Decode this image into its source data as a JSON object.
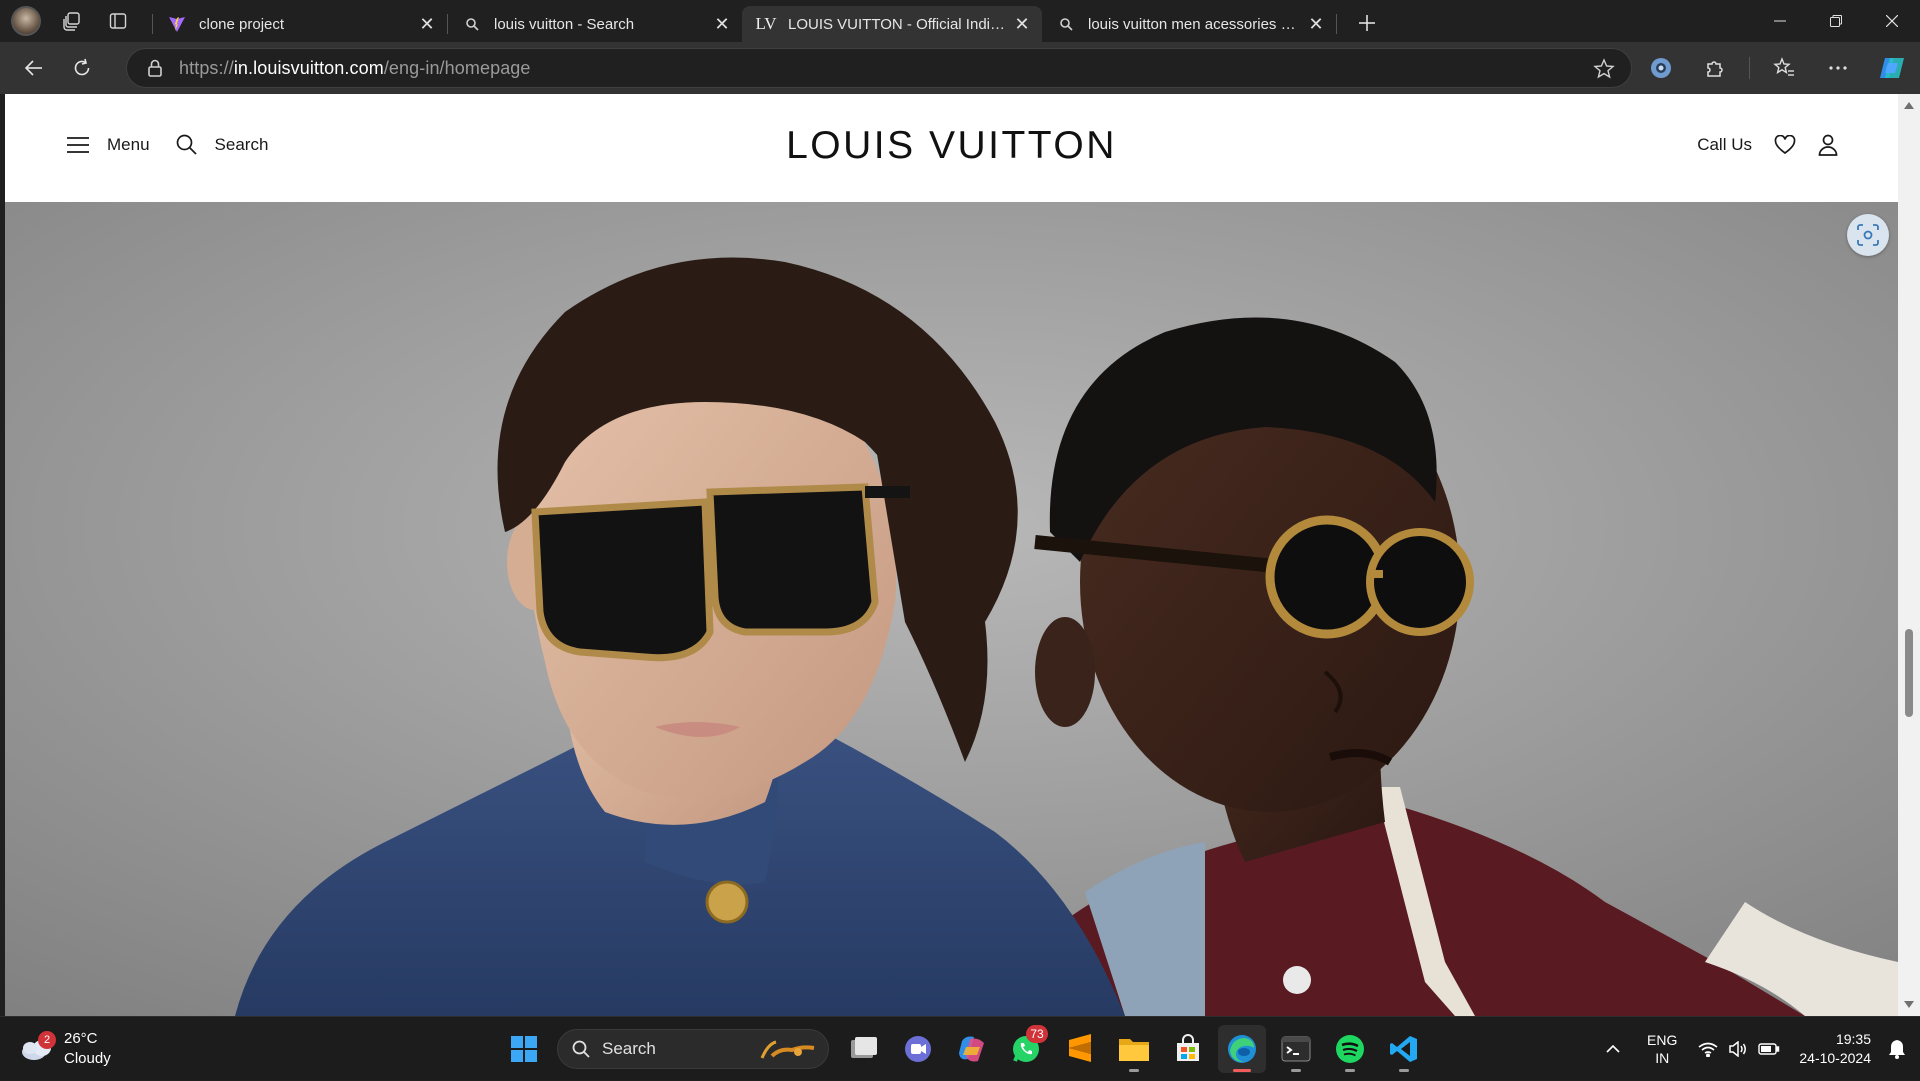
{
  "browser": {
    "tabs": [
      {
        "label": "clone project",
        "active": false
      },
      {
        "label": "louis vuitton - Search",
        "active": false
      },
      {
        "label": "LOUIS VUITTON - Official India W",
        "active": true
      },
      {
        "label": "louis vuitton men acessories - Sea",
        "active": false
      }
    ],
    "url_prefix": "https://",
    "url_host": "in.louisvuitton.com",
    "url_path": "/eng-in/homepage"
  },
  "site": {
    "menu_label": "Menu",
    "search_label": "Search",
    "logo": "LOUIS VUITTON",
    "call_us": "Call Us"
  },
  "taskbar": {
    "weather_temp": "26°C",
    "weather_desc": "Cloudy",
    "weather_badge": "2",
    "search_label": "Search",
    "whatsapp_badge": "73",
    "lang_top": "ENG",
    "lang_bottom": "IN",
    "time": "19:35",
    "date": "24-10-2024"
  },
  "colors": {
    "accent_active_tab": "#333333",
    "taskbar_bg": "#1c1c1c",
    "edge_running": "#f25c5c"
  }
}
